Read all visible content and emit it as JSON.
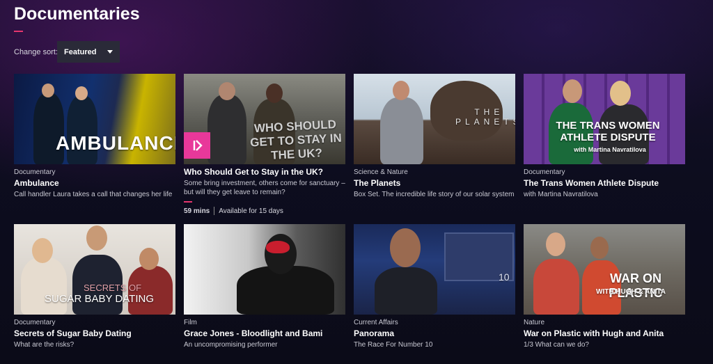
{
  "header": {
    "title": "Documentaries"
  },
  "sort": {
    "label": "Change sort:",
    "value": "Featured"
  },
  "cards": [
    {
      "genre": "Documentary",
      "title": "Ambulance",
      "description": "Call handler Laura takes a call that changes her life",
      "thumb_text": "AMBULANCE"
    },
    {
      "genre": "",
      "title": "Who Should Get to Stay in the UK?",
      "description": "Some bring investment, others come for sanctuary – but will they get leave to remain?",
      "thumb_text": "WHO SHOULD GET TO STAY IN THE UK?",
      "duration": "59 mins",
      "availability": "Available for 15 days"
    },
    {
      "genre": "Science & Nature",
      "title": "The Planets",
      "description": "Box Set. The incredible life story of our solar system",
      "thumb_text": "THE PLANETS"
    },
    {
      "genre": "Documentary",
      "title": "The Trans Women Athlete Dispute",
      "description": "with Martina Navratilova",
      "thumb_text": "THE TRANS WOMEN ATHLETE DISPUTE",
      "thumb_subtext": "with Martina Navratilova"
    },
    {
      "genre": "Documentary",
      "title": "Secrets of Sugar Baby Dating",
      "description": "What are the risks?",
      "thumb_text_top": "SECRETS OF",
      "thumb_text": "SUGAR BABY DATING"
    },
    {
      "genre": "Film",
      "title": "Grace Jones - Bloodlight and Bami",
      "description": "An uncompromising performer"
    },
    {
      "genre": "Current Affairs",
      "title": "Panorama",
      "description": "The Race For Number 10",
      "thumb_text": "10"
    },
    {
      "genre": "Nature",
      "title": "War on Plastic with Hugh and Anita",
      "description": "1/3 What can we do?",
      "thumb_text": "WAR ON PLASTIC",
      "thumb_subtext": "WITH HUGH & ANITA"
    }
  ]
}
